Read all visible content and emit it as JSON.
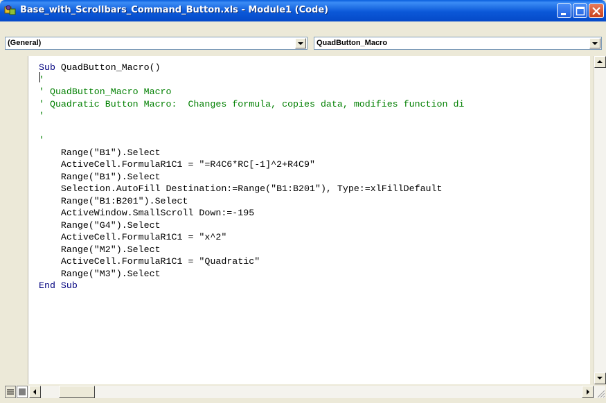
{
  "window": {
    "title": "Base_with_Scrollbars_Command_Button.xls - Module1 (Code)"
  },
  "object_combo": {
    "value": "(General)"
  },
  "procedure_combo": {
    "value": "QuadButton_Macro"
  },
  "code_lines": [
    [
      {
        "t": "Sub",
        "c": "kw"
      },
      {
        "t": " QuadButton_Macro()",
        "c": ""
      }
    ],
    [
      {
        "t": "'",
        "c": "cm"
      }
    ],
    [
      {
        "t": "' QuadButton_Macro Macro",
        "c": "cm"
      }
    ],
    [
      {
        "t": "' Quadratic Button Macro:  Changes formula, copies data, modifies function di",
        "c": "cm"
      }
    ],
    [
      {
        "t": "'",
        "c": "cm"
      }
    ],
    [
      {
        "t": "",
        "c": ""
      }
    ],
    [
      {
        "t": "'",
        "c": "cm"
      }
    ],
    [
      {
        "t": "    Range(\"B1\").Select",
        "c": ""
      }
    ],
    [
      {
        "t": "    ActiveCell.FormulaR1C1 = \"=R4C6*RC[-1]^2+R4C9\"",
        "c": ""
      }
    ],
    [
      {
        "t": "    Range(\"B1\").Select",
        "c": ""
      }
    ],
    [
      {
        "t": "    Selection.AutoFill Destination:=Range(\"B1:B201\"), Type:=xlFillDefault",
        "c": ""
      }
    ],
    [
      {
        "t": "    Range(\"B1:B201\").Select",
        "c": ""
      }
    ],
    [
      {
        "t": "    ActiveWindow.SmallScroll Down:=-195",
        "c": ""
      }
    ],
    [
      {
        "t": "    Range(\"G4\").Select",
        "c": ""
      }
    ],
    [
      {
        "t": "    ActiveCell.FormulaR1C1 = \"x^2\"",
        "c": ""
      }
    ],
    [
      {
        "t": "    Range(\"M2\").Select",
        "c": ""
      }
    ],
    [
      {
        "t": "    ActiveCell.FormulaR1C1 = \"Quadratic\"",
        "c": ""
      }
    ],
    [
      {
        "t": "    Range(\"M3\").Select",
        "c": ""
      }
    ],
    [
      {
        "t": "End Sub",
        "c": "kw"
      }
    ]
  ],
  "colors": {
    "keyword": "#00007f",
    "comment": "#007f00",
    "titlebar": "#0b58d8"
  },
  "icons": [
    "vba-module-icon",
    "minimize-icon",
    "maximize-icon",
    "close-icon",
    "chevron-down-icon",
    "scroll-up-icon",
    "scroll-down-icon",
    "scroll-left-icon",
    "scroll-right-icon",
    "procedure-view-icon",
    "full-module-view-icon"
  ]
}
